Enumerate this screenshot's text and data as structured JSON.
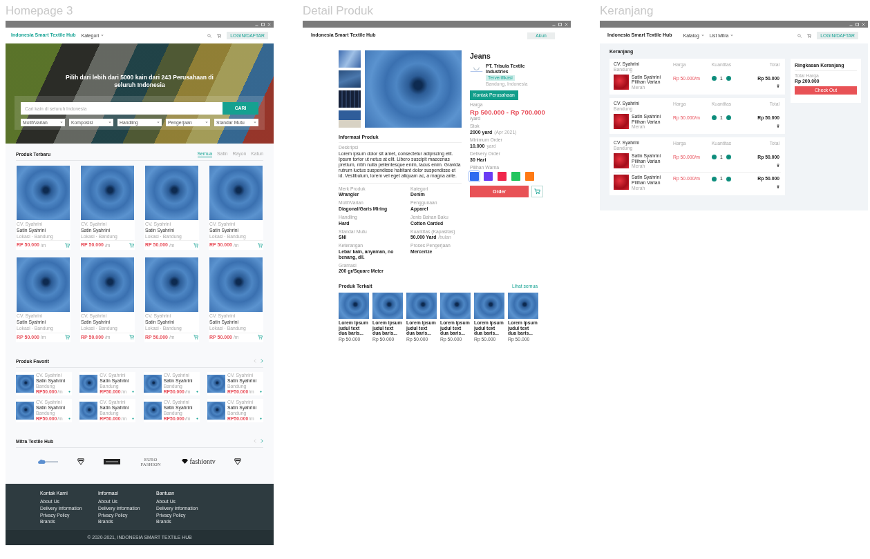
{
  "homepage": {
    "artboard_title": "Homepage 3",
    "nav": {
      "logo": "Indonesia Smart Textile Hub",
      "menu": [
        "Kategori"
      ],
      "login_button": "LOGIN/DAFTAR"
    },
    "hero": {
      "headline": "Pilih dari lebih dari 5000 kain dari 243 Perusahaan di seluruh Indonesia",
      "search": {
        "placeholder": "Cari kain di seluruh Indonesia",
        "button": "CARI"
      },
      "filters": [
        "Motif/Varian",
        "Komposisi",
        "Handling",
        "Pengerjaan",
        "Standar Mutu"
      ]
    },
    "latest": {
      "title": "Produk Terbaru",
      "tabs": [
        {
          "label": "Semua",
          "selected": true
        },
        {
          "label": "Satin",
          "selected": false
        },
        {
          "label": "Rayon",
          "selected": false
        },
        {
          "label": "Katun",
          "selected": false
        }
      ],
      "products": [
        {
          "seller": "CV. Syahrini",
          "name": "Satin Syahrini",
          "location": "Lokasi · Bandung",
          "price": "RP 50.000",
          "unit": "/m"
        },
        {
          "seller": "CV. Syahrini",
          "name": "Satin Syahrini",
          "location": "Lokasi · Bandung",
          "price": "RP 50.000",
          "unit": "/m"
        },
        {
          "seller": "CV. Syahrini",
          "name": "Satin Syahrini",
          "location": "Lokasi · Bandung",
          "price": "RP 50.000",
          "unit": "/m"
        },
        {
          "seller": "CV. Syahrini",
          "name": "Satin Syahrini",
          "location": "Lokasi · Bandung",
          "price": "RP 50.000",
          "unit": "/m"
        },
        {
          "seller": "CV. Syahrini",
          "name": "Satin Syahrini",
          "location": "Lokasi · Bandung",
          "price": "RP 50.000",
          "unit": "/m"
        },
        {
          "seller": "CV. Syahrini",
          "name": "Satin Syahrini",
          "location": "Lokasi · Bandung",
          "price": "RP 50.000",
          "unit": "/m"
        },
        {
          "seller": "CV. Syahrini",
          "name": "Satin Syahrini",
          "location": "Lokasi · Bandung",
          "price": "RP 50.000",
          "unit": "/m"
        },
        {
          "seller": "CV. Syahrini",
          "name": "Satin Syahrini",
          "location": "Lokasi · Bandung",
          "price": "RP 50.000",
          "unit": "/m"
        }
      ]
    },
    "favorites": {
      "title": "Produk Favorit",
      "arrows": [
        {
          "kind": "prev",
          "disabled": true
        },
        {
          "kind": "next",
          "disabled": false
        }
      ],
      "products": [
        {
          "seller": "CV. Syahrini",
          "name": "Satin Syahrini",
          "location": "Bandung",
          "price": "RP50.000",
          "unit": "/m"
        },
        {
          "seller": "CV. Syahrini",
          "name": "Satin Syahrini",
          "location": "Bandung",
          "price": "RP50.000",
          "unit": "/m"
        },
        {
          "seller": "CV. Syahrini",
          "name": "Satin Syahrini",
          "location": "Bandung",
          "price": "RP50.000",
          "unit": "/m"
        },
        {
          "seller": "CV. Syahrini",
          "name": "Satin Syahrini",
          "location": "Bandung",
          "price": "RP50.000",
          "unit": "/m"
        },
        {
          "seller": "CV. Syahrini",
          "name": "Satin Syahrini",
          "location": "Bandung",
          "price": "RP50.000",
          "unit": "/m"
        },
        {
          "seller": "CV. Syahrini",
          "name": "Satin Syahrini",
          "location": "Bandung",
          "price": "RP50.000",
          "unit": "/m"
        },
        {
          "seller": "CV. Syahrini",
          "name": "Satin Syahrini",
          "location": "Bandung",
          "price": "RP50.000",
          "unit": "/m"
        },
        {
          "seller": "CV. Syahrini",
          "name": "Satin Syahrini",
          "location": "Bandung",
          "price": "RP50.000",
          "unit": "/m"
        }
      ]
    },
    "partners": {
      "title": "Mitra Textile Hub",
      "arrows": [
        {
          "kind": "prev",
          "disabled": true
        },
        {
          "kind": "next",
          "disabled": false
        }
      ],
      "logos": [
        {
          "kind": "cloud"
        },
        {
          "kind": "shield"
        },
        {
          "kind": "block"
        },
        {
          "kind": "euro",
          "text": "EURO FASHION"
        },
        {
          "kind": "diamond",
          "text": "fashiontv"
        },
        {
          "kind": "shield"
        }
      ]
    },
    "footer": {
      "columns": [
        {
          "title": "Kontak Kami",
          "links": [
            "About Us",
            "Delivery Information",
            "Privacy Policy",
            "Brands"
          ]
        },
        {
          "title": "Informasi",
          "links": [
            "About Us",
            "Delivery Information",
            "Privacy Policy",
            "Brands"
          ]
        },
        {
          "title": "Bantuan",
          "links": [
            "About Us",
            "Delivery Information",
            "Privacy Policy",
            "Brands"
          ]
        }
      ],
      "copyright": "© 2020-2021, INDONESIA SMART TEXTILE HUB"
    }
  },
  "detail": {
    "artboard_title": "Detail Produk",
    "nav": {
      "logo": "Indonesia Smart Textile Hub",
      "account_button": "Akun"
    },
    "product": {
      "name": "Jeans",
      "company": "PT. Trisula Textile Industries",
      "company_badge": "Terverifikasi",
      "company_location": "Bandung, Indonesia",
      "contact_button": "Kontak Perusahaan",
      "price_label": "Harga",
      "price": "Rp 500.000 - Rp 700.000",
      "price_unit": "/yard",
      "facts": [
        {
          "label": "Stok",
          "value": "2000 yard",
          "note": "(Apr 2021)"
        },
        {
          "label": "Minimum Order",
          "value": "10.000",
          "note": "yard"
        },
        {
          "label": "Delivery Order",
          "value": "30 Hari"
        }
      ],
      "colors_label": "Pilihan Warna",
      "colors": [
        {
          "color": "#2f6cf0",
          "selected": true
        },
        {
          "color": "#6b3cf4",
          "selected": false
        },
        {
          "color": "#f0264b",
          "selected": false
        },
        {
          "color": "#22c55e",
          "selected": false
        },
        {
          "color": "#ff7a14",
          "selected": false
        }
      ],
      "order_button": "Order"
    },
    "info": {
      "title": "Informasi Produk",
      "description_label": "Deskripsi",
      "description": "Lorem ipsum dolor sit amet, consectetur adipiscing elit. Ipsum tortor ut netus at elit. Libero suscipit maecenas pretium, nibh nulla pellentesque enim, lacus enim. Gravida rutrum luctus suspendisse habitant dolor suspendisse et id. Vestibulum, lorem vel eget aliquam ac, a magna ante.",
      "attributes": [
        {
          "label": "Merk Produk",
          "value": "Wrangler"
        },
        {
          "label": "Kategori",
          "value": "Denim"
        },
        {
          "label": "Motif/Varian",
          "value": "Diagonal/Garis Miring"
        },
        {
          "label": "Penggunaan",
          "value": "Apparel"
        },
        {
          "label": "Handling",
          "value": "Hard"
        },
        {
          "label": "Jenis Bahan Baku",
          "value": "Cotton Carded"
        },
        {
          "label": "Standar Mutu",
          "value": "SNI"
        },
        {
          "label": "Kuantitas (Kapasitas)",
          "value": "50.000 Yard",
          "note": "/bulan"
        },
        {
          "label": "Keterangan",
          "value": "Lebar kain, anyaman, no benang, dll."
        },
        {
          "label": "Proses Pengerjaan",
          "value": "Mercerize"
        },
        {
          "label": "Gramasi",
          "value": "200 gr/Square Meter"
        }
      ]
    },
    "related": {
      "title": "Produk Terkait",
      "see_all": "Lihat semua",
      "items": [
        {
          "name": "Lorem ipsum judul text dua baris...",
          "price": "Rp 50.000"
        },
        {
          "name": "Lorem ipsum judul text dua baris...",
          "price": "Rp 50.000"
        },
        {
          "name": "Lorem ipsum judul text dua baris...",
          "price": "Rp 50.000"
        },
        {
          "name": "Lorem ipsum judul text dua baris...",
          "price": "Rp 50.000"
        },
        {
          "name": "Lorem ipsum judul text dua baris...",
          "price": "Rp 50.000"
        },
        {
          "name": "Lorem ipsum judul text dua baris...",
          "price": "Rp 50.000"
        }
      ]
    }
  },
  "cart": {
    "artboard_title": "Keranjang",
    "nav": {
      "logo": "Indonesia Smart Textile Hub",
      "menu": [
        "Katalog",
        "List Mitra"
      ],
      "login_button": "LOGIN/DAFTAR"
    },
    "title": "Keranjang",
    "groups": [
      {
        "store": "CV. Syahrini",
        "location": "Bandung",
        "columns": [
          "Harga",
          "Kuantitas",
          "Total"
        ],
        "items": [
          {
            "name": "Satin Syahrini",
            "variant_label": "Pilihan Varian",
            "variant": "Merah",
            "price": "Rp 50.000/m",
            "quantity": "1",
            "total": "Rp 50.000"
          }
        ]
      },
      {
        "store": "CV. Syahrini",
        "location": "Bandung",
        "columns": [
          "Harga",
          "Kuantitas",
          "Total"
        ],
        "items": [
          {
            "name": "Satin Syahrini",
            "variant_label": "Pilihan Varian",
            "variant": "Merah",
            "price": "Rp 50.000/m",
            "quantity": "1",
            "total": "Rp 50.000"
          }
        ]
      },
      {
        "store": "CV. Syahrini",
        "location": "Bandung",
        "columns": [
          "Harga",
          "Kuantitas",
          "Total"
        ],
        "items": [
          {
            "name": "Satin Syahrini",
            "variant_label": "Pilihan Varian",
            "variant": "Merah",
            "price": "Rp 50.000/m",
            "quantity": "1",
            "total": "Rp 50.000"
          },
          {
            "name": "Satin Syahrini",
            "variant_label": "Pilihan Varian",
            "variant": "Merah",
            "price": "Rp 50.000/m",
            "quantity": "1",
            "total": "Rp 50.000"
          }
        ]
      }
    ],
    "summary": {
      "title": "Ringkasan Keranjang",
      "total_label": "Total Harga",
      "total": "Rp 200.000",
      "checkout_button": "Check Out"
    }
  }
}
